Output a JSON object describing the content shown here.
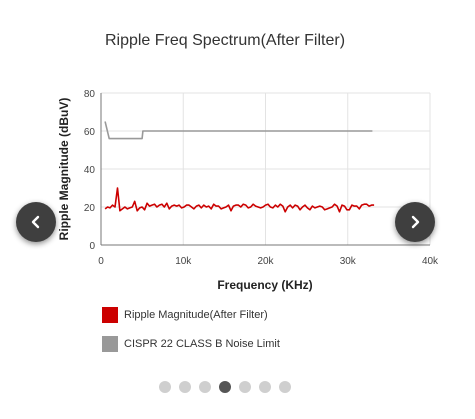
{
  "chart_data": {
    "type": "line",
    "title": "Ripple Freq Spectrum(After Filter)",
    "xlabel": "Frequency (KHz)",
    "ylabel": "Ripple Magnitude (dBuV)",
    "xlim": [
      0,
      40000
    ],
    "ylim": [
      0,
      80
    ],
    "x_ticks": [
      0,
      10000,
      20000,
      30000,
      40000
    ],
    "x_tick_labels": [
      "0",
      "10k",
      "20k",
      "30k",
      "40k"
    ],
    "y_ticks": [
      0,
      20,
      40,
      60,
      80
    ],
    "y_tick_labels": [
      "0",
      "20",
      "40",
      "60",
      "80"
    ],
    "grid": true,
    "legend_position": "bottom-left",
    "series": [
      {
        "name": "Ripple Magnitude(After Filter)",
        "color": "#cc0000",
        "x": [
          500,
          800,
          1100,
          1400,
          1700,
          2000,
          2300,
          2600,
          2900,
          3200,
          3500,
          3800,
          4100,
          4400,
          4700,
          5000,
          5300,
          5600,
          5900,
          6200,
          6500,
          6800,
          7100,
          7400,
          7700,
          8000,
          8300,
          8600,
          8900,
          9200,
          9500,
          9800,
          10100,
          10400,
          10700,
          11000,
          11300,
          11600,
          11900,
          12200,
          12500,
          12800,
          13100,
          13400,
          13700,
          14000,
          14300,
          14600,
          14900,
          15200,
          15500,
          15800,
          16100,
          16400,
          16700,
          17000,
          17300,
          17600,
          17900,
          18200,
          18500,
          18800,
          19100,
          19400,
          19700,
          20000,
          20300,
          20600,
          20900,
          21200,
          21500,
          21800,
          22100,
          22400,
          22700,
          23000,
          23300,
          23600,
          23900,
          24200,
          24500,
          24800,
          25100,
          25400,
          25700,
          26000,
          26300,
          26600,
          26900,
          27200,
          27500,
          27800,
          28100,
          28400,
          28700,
          29000,
          29300,
          29600,
          29900,
          30200,
          30500,
          30800,
          31100,
          31400,
          31700,
          32000,
          32300,
          32600,
          32900,
          33200
        ],
        "values": [
          19,
          20,
          19.5,
          21,
          20,
          30,
          18,
          19,
          20,
          19,
          19.5,
          20,
          23,
          18,
          19.5,
          20,
          18.5,
          22,
          20.5,
          21,
          21.5,
          20,
          21,
          21.5,
          20,
          22,
          19,
          20.5,
          21,
          20.5,
          21,
          19.5,
          20,
          21,
          21,
          20,
          19,
          20.5,
          21,
          19.5,
          21,
          20,
          20.5,
          19,
          21.5,
          20.5,
          20.5,
          19,
          19.5,
          20,
          21,
          18,
          20.5,
          21,
          21,
          20,
          21.5,
          21,
          19.5,
          20,
          21.5,
          20.5,
          20,
          19.5,
          20,
          21,
          21.5,
          20,
          19.5,
          21,
          20,
          21.5,
          20.5,
          17.5,
          20,
          21,
          19.5,
          21,
          20.5,
          18.5,
          20,
          21,
          19.5,
          18.5,
          20.5,
          19.5,
          20,
          20.5,
          20,
          18.5,
          19,
          19.5,
          20,
          21.5,
          20.5,
          17.5,
          21,
          20.5,
          18.5,
          18.5,
          21,
          20.5,
          20.5,
          19,
          21,
          21.5,
          21.5,
          20.5,
          21,
          21
        ]
      },
      {
        "name": "CISPR 22 CLASS B Noise Limit",
        "color": "#999999",
        "x": [
          500,
          1000,
          5000,
          5100,
          33000
        ],
        "values": [
          65,
          56,
          56,
          60,
          60
        ]
      }
    ]
  },
  "legend": {
    "item1": "Ripple Magnitude(After Filter)",
    "item2": "CISPR 22 CLASS B Noise Limit"
  },
  "nav": {
    "prev_icon": "chevron-left-icon",
    "next_icon": "chevron-right-icon"
  },
  "pagination": {
    "count": 7,
    "active_index": 3
  }
}
